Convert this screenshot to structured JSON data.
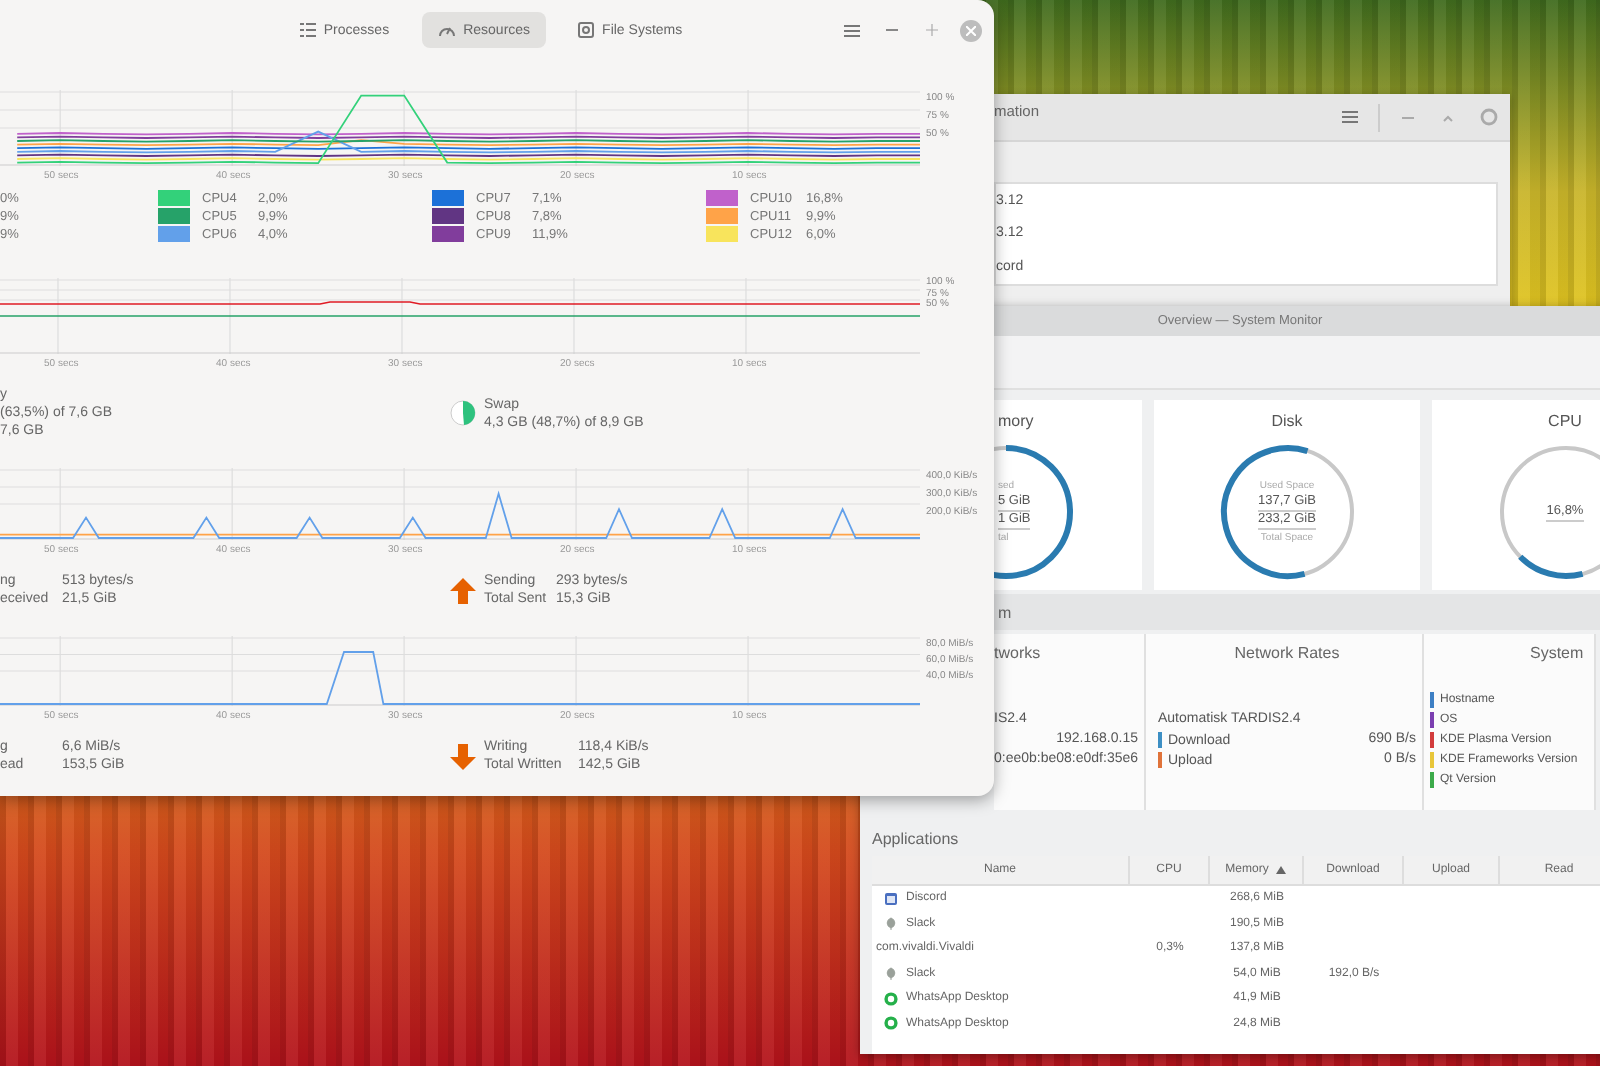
{
  "monitor_window": {
    "tabs": [
      {
        "label": "Processes",
        "selected": false
      },
      {
        "label": "Resources",
        "selected": true
      },
      {
        "label": "File Systems",
        "selected": false
      }
    ],
    "cpu": {
      "chart_data": {
        "type": "line",
        "grid": true,
        "x": [
          -52.5,
          -50,
          -47.5,
          -45,
          -42.5,
          -40,
          -37.5,
          -35,
          -32.5,
          -30,
          -27.5,
          -25,
          -22.5,
          -20,
          -17.5,
          -15,
          -12.5,
          -10,
          -7.5,
          -5,
          -2.5,
          0
        ],
        "xlim": [
          -53.5,
          0
        ],
        "ylim": [
          0,
          100
        ],
        "xticks": [
          {
            "value": -50,
            "label": "50 secs"
          },
          {
            "value": -40,
            "label": "40 secs"
          },
          {
            "value": -30,
            "label": "30 secs"
          },
          {
            "value": -20,
            "label": "20 secs"
          },
          {
            "value": -10,
            "label": "10 secs"
          }
        ],
        "yticks": [
          {
            "value": 100,
            "label": "100 %"
          },
          {
            "value": 75,
            "label": "75 %"
          },
          {
            "value": 50,
            "label": "50 %"
          }
        ],
        "series": [
          {
            "name": "CPU4",
            "color": "#33d17a",
            "values": [
              2,
              3,
              2,
              1,
              2,
              3,
              2,
              1,
              95,
              95,
              2,
              1,
              2,
              3,
              2,
              1,
              2,
              3,
              2,
              1,
              2,
              2
            ]
          },
          {
            "name": "CPU5",
            "color": "#26a269",
            "values": [
              32,
              33,
              32,
              31,
              32,
              33,
              32,
              31,
              32,
              33,
              32,
              31,
              32,
              33,
              32,
              31,
              32,
              33,
              32,
              31,
              32,
              32
            ]
          },
          {
            "name": "CPU6",
            "color": "#62a0ea",
            "values": [
              17,
              18,
              17,
              16,
              17,
              18,
              17,
              45,
              17,
              18,
              17,
              16,
              17,
              18,
              17,
              16,
              17,
              18,
              17,
              16,
              17,
              17
            ]
          },
          {
            "name": "CPU7",
            "color": "#1c71d8",
            "values": [
              22,
              23,
              22,
              21,
              22,
              23,
              22,
              21,
              22,
              23,
              22,
              21,
              22,
              23,
              22,
              21,
              22,
              23,
              22,
              21,
              22,
              22
            ]
          },
          {
            "name": "CPU8",
            "color": "#613583",
            "values": [
              12,
              13,
              12,
              11,
              12,
              13,
              12,
              11,
              12,
              13,
              12,
              11,
              12,
              13,
              12,
              11,
              12,
              13,
              12,
              11,
              12,
              12
            ]
          },
          {
            "name": "CPU9",
            "color": "#813d9c",
            "values": [
              37,
              38,
              37,
              36,
              37,
              38,
              37,
              36,
              37,
              38,
              37,
              36,
              37,
              38,
              37,
              36,
              37,
              38,
              37,
              36,
              37,
              37
            ]
          },
          {
            "name": "CPU10",
            "color": "#c061cb",
            "values": [
              42,
              43,
              42,
              41,
              42,
              43,
              42,
              41,
              42,
              43,
              42,
              41,
              42,
              43,
              42,
              41,
              42,
              43,
              42,
              41,
              42,
              42
            ]
          },
          {
            "name": "CPU11",
            "color": "#ffa348",
            "values": [
              27,
              28,
              27,
              26,
              27,
              28,
              27,
              26,
              33,
              28,
              27,
              26,
              27,
              28,
              27,
              26,
              27,
              28,
              27,
              26,
              27,
              27
            ]
          },
          {
            "name": "CPU12",
            "color": "#f8e45c",
            "values": [
              7,
              8,
              7,
              6,
              7,
              8,
              7,
              6,
              7,
              8,
              7,
              6,
              7,
              8,
              7,
              6,
              7,
              8,
              7,
              6,
              7,
              7
            ]
          }
        ]
      },
      "hidden_values": [
        "0%",
        "9%",
        "9%"
      ],
      "readings": [
        "2,0%",
        "9,9%",
        "4,0%",
        "7,1%",
        "7,8%",
        "11,9%",
        "16,8%",
        "9,9%",
        "6,0%"
      ]
    },
    "memory": {
      "y_labels": [
        "100 %",
        "75 %",
        "50 %"
      ],
      "x_labels": [
        "50 secs",
        "40 secs",
        "30 secs",
        "20 secs",
        "10 secs"
      ],
      "memory_lines": [
        "y",
        "(63,5%) of 7,6 GB",
        "7,6 GB"
      ],
      "swap": {
        "label": "Swap",
        "detail": "4,3 GB (48,7%) of 8,9 GB",
        "level": 0.487
      }
    },
    "network": {
      "chart_data": {
        "type": "line",
        "grid": true,
        "x": [
          -53.5,
          -49.25,
          -48.5,
          -47.75,
          -42.25,
          -41.5,
          -40.75,
          -36.25,
          -35.5,
          -34.75,
          -30.25,
          -29.5,
          -28.75,
          -25.25,
          -24.5,
          -23.75,
          -18.25,
          -17.5,
          -16.75,
          -12.25,
          -11.5,
          -10.75,
          -5.25,
          -4.5,
          -3.75,
          0
        ],
        "xlim": [
          -53.5,
          0
        ],
        "ylim": [
          0,
          400
        ],
        "xticks": [
          {
            "value": -50,
            "label": "50 secs"
          },
          {
            "value": -40,
            "label": "40 secs"
          },
          {
            "value": -30,
            "label": "30 secs"
          },
          {
            "value": -20,
            "label": "20 secs"
          },
          {
            "value": -10,
            "label": "10 secs"
          }
        ],
        "yticks": [
          {
            "value": 400,
            "label": "400,0 KiB/s"
          },
          {
            "value": 300,
            "label": "300,0 KiB/s"
          },
          {
            "value": 200,
            "label": "200,0 KiB/s"
          }
        ],
        "series": [
          {
            "color": "#62a0ea",
            "values": [
              0,
              0,
              120,
              0,
              0,
              120,
              0,
              0,
              120,
              0,
              0,
              120,
              0,
              0,
              260,
              0,
              0,
              170,
              0,
              0,
              170,
              0,
              0,
              170,
              0,
              0
            ]
          },
          {
            "color": "#ffa348",
            "values": [
              20,
              20,
              20,
              20,
              20,
              20,
              20,
              20,
              20,
              20,
              20,
              20,
              20,
              20,
              20,
              20,
              20,
              20,
              20,
              20,
              20,
              20,
              20,
              20,
              20,
              20
            ]
          }
        ]
      },
      "left_rows": [
        {
          "label": "ng",
          "value": "513 bytes/s"
        },
        {
          "label": "eceived",
          "value": "21,5 GiB"
        }
      ],
      "right_rows": [
        {
          "label": "Sending",
          "value": "293 bytes/s"
        },
        {
          "label": "Total Sent",
          "value": "15,3 GiB"
        }
      ]
    },
    "disk": {
      "chart_data": {
        "type": "line",
        "grid": true,
        "x": [
          -53.5,
          -34.5,
          -33.5,
          -31.8,
          -31.2,
          0
        ],
        "xlim": [
          -53.5,
          0
        ],
        "ylim": [
          0,
          80
        ],
        "xticks": [
          {
            "value": -50,
            "label": "50 secs"
          },
          {
            "value": -40,
            "label": "40 secs"
          },
          {
            "value": -30,
            "label": "30 secs"
          },
          {
            "value": -20,
            "label": "20 secs"
          },
          {
            "value": -10,
            "label": "10 secs"
          }
        ],
        "yticks": [
          {
            "value": 80,
            "label": "80,0 MiB/s"
          },
          {
            "value": 60,
            "label": "60,0 MiB/s"
          },
          {
            "value": 40,
            "label": "40,0 MiB/s"
          }
        ],
        "series": [
          {
            "color": "#62a0ea",
            "values": [
              0,
              0,
              63,
              63,
              0,
              0
            ]
          }
        ]
      },
      "left_rows": [
        {
          "label": "g",
          "value": "6,6 MiB/s"
        },
        {
          "label": "ead",
          "value": "153,5 GiB"
        }
      ],
      "right_rows": [
        {
          "label": "Writing",
          "value": "118,4 KiB/s"
        },
        {
          "label": "Total Written",
          "value": "142,5 GiB"
        }
      ]
    }
  },
  "info_window": {
    "title": "mation",
    "lines": [
      "3.12",
      "3.12",
      "cord"
    ]
  },
  "overview_window": {
    "title": "Overview — System Monitor",
    "cards": [
      {
        "title": "mory",
        "level": 0.62,
        "lines": [
          {
            "kind": "caption",
            "text": "sed"
          },
          {
            "kind": "value",
            "text": "5 GiB"
          },
          {
            "kind": "value",
            "text": "1 GiB"
          },
          {
            "kind": "caption",
            "text": "tal"
          }
        ]
      },
      {
        "title": "Disk",
        "level": 0.59,
        "lines": [
          {
            "kind": "caption",
            "text": "Used Space"
          },
          {
            "kind": "value",
            "text": "137,7 GiB"
          },
          {
            "kind": "value",
            "text": "233,2 GiB"
          },
          {
            "kind": "caption",
            "text": "Total Space"
          }
        ]
      },
      {
        "title": "CPU",
        "level": 0.168,
        "lines": [
          {
            "kind": "value",
            "text": "16,8%"
          }
        ]
      }
    ],
    "section_title": "m",
    "networks": {
      "title": "tworks",
      "name": "IS2.4",
      "address": "192.168.0.15",
      "ipv6": "0:ee0b:be08:e0df:35e6"
    },
    "rates": {
      "title": "Network Rates",
      "name": "Automatisk TARDIS2.4",
      "rows": [
        {
          "label": "Download",
          "value": "690 B/s",
          "color": "#3d8fc4"
        },
        {
          "label": "Upload",
          "value": "0 B/s",
          "color": "#e0733a"
        }
      ]
    },
    "system": {
      "title": "System",
      "items": [
        {
          "label": "Hostname",
          "color": "#3d7fc4"
        },
        {
          "label": "OS",
          "color": "#7b3fb0"
        },
        {
          "label": "KDE Plasma Version",
          "color": "#d23c3c"
        },
        {
          "label": "KDE Frameworks Version",
          "color": "#e8c63a"
        },
        {
          "label": "Qt Version",
          "color": "#3caa4a"
        }
      ]
    },
    "applications": {
      "title": "Applications",
      "columns": [
        {
          "label": "Name",
          "sorted": false
        },
        {
          "label": "CPU",
          "sorted": false
        },
        {
          "label": "Memory",
          "sorted": true
        },
        {
          "label": "Download",
          "sorted": false
        },
        {
          "label": "Upload",
          "sorted": false
        },
        {
          "label": "Read",
          "sorted": false
        }
      ],
      "rows": [
        {
          "kind": "window",
          "name": "Discord",
          "memory": "268,6 MiB"
        },
        {
          "kind": "leaf",
          "name": "Slack",
          "memory": "190,5 MiB"
        },
        {
          "kind": "plain",
          "name": "com.vivaldi.Vivaldi",
          "cpu": "0,3%",
          "memory": "137,8 MiB"
        },
        {
          "kind": "leaf",
          "name": "Slack",
          "memory": "54,0 MiB",
          "download": "192,0 B/s"
        },
        {
          "kind": "chat",
          "name": "WhatsApp Desktop",
          "memory": "41,9 MiB"
        },
        {
          "kind": "chat",
          "name": "WhatsApp Desktop",
          "memory": "24,8 MiB"
        }
      ]
    }
  }
}
